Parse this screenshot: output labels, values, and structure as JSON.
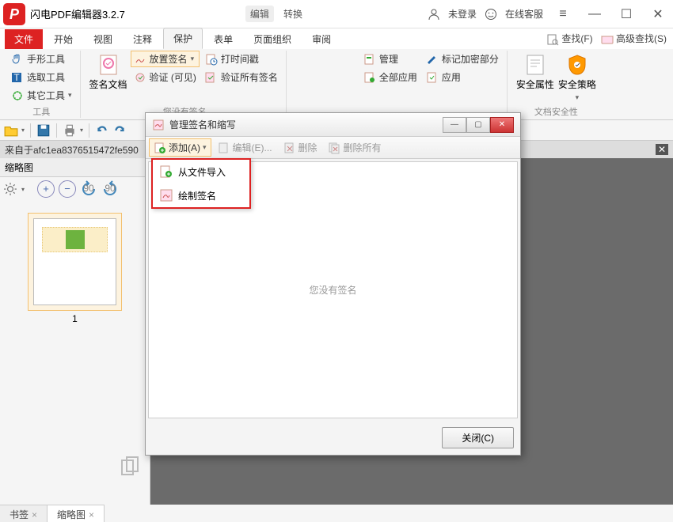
{
  "titlebar": {
    "app_name": "闪电PDF编辑器3.2.7",
    "edit": "编辑",
    "convert": "转换",
    "not_logged": "未登录",
    "online_service": "在线客服"
  },
  "tabs": {
    "file": "文件",
    "start": "开始",
    "view": "视图",
    "annotate": "注释",
    "protect": "保护",
    "form": "表单",
    "page_org": "页面组织",
    "review": "审阅",
    "find": "查找(F)",
    "adv_find": "高级查找(S)"
  },
  "ribbon": {
    "tools": {
      "hand": "手形工具",
      "select": "选取工具",
      "other": "其它工具",
      "group": "工具"
    },
    "sign": {
      "doc": "签名文档",
      "place": "放置签名",
      "verify": "验证 (可见)",
      "time": "打时间戳",
      "verify_all": "验证所有签名",
      "none": "您没有签名"
    },
    "colab": {
      "manage": "管理",
      "all_apply": "全部应用",
      "mark_encrypt": "标记加密部分",
      "apply": "应用"
    },
    "security": {
      "prop": "安全属性",
      "policy": "安全策略",
      "group": "文档安全性"
    }
  },
  "docbar": {
    "name": "来自于afc1ea8376515472fe590"
  },
  "side": {
    "header": "缩略图",
    "num": "1"
  },
  "bottom": {
    "bookmark": "书签",
    "thumb": "缩略图"
  },
  "modal": {
    "title": "管理签名和缩写",
    "toolbar": {
      "add": "添加(A)",
      "edit": "编辑(E)...",
      "del": "删除",
      "del_all": "删除所有"
    },
    "body_empty": "您没有签名",
    "close": "关闭(C)",
    "dd": {
      "from_file": "从文件导入",
      "draw": "绘制签名"
    }
  }
}
